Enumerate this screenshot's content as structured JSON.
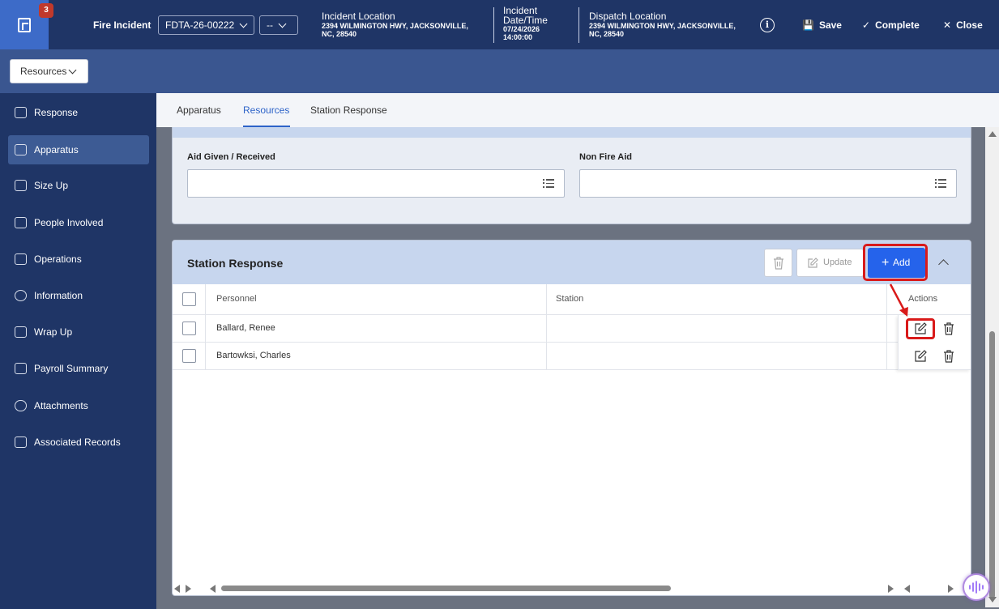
{
  "header": {
    "badge_count": "3",
    "title": "Fire Incident",
    "incident_id": "FDTA-26-00222",
    "secondary_select": "--",
    "incident_location_label": "Incident Location",
    "incident_location_value_line1": "2394 WILMINGTON HWY, JACKSONVILLE,",
    "incident_location_value_line2": "NC, 28540",
    "incident_datetime_label_line1": "Incident",
    "incident_datetime_label_line2": "Date/Time",
    "incident_datetime_value_line1": "07/24/2026",
    "incident_datetime_value_line2": "14:00:00",
    "dispatch_location_label": "Dispatch Location",
    "dispatch_location_value_line1": "2394 WILMINGTON HWY, JACKSONVILLE,",
    "dispatch_location_value_line2": "NC, 28540",
    "save_label": "Save",
    "complete_label": "Complete",
    "close_label": "Close"
  },
  "subbar": {
    "dropdown_label": "Resources"
  },
  "sidebar": {
    "items": [
      {
        "label": "Response",
        "icon": "response-icon"
      },
      {
        "label": "Apparatus",
        "icon": "apparatus-icon"
      },
      {
        "label": "Size Up",
        "icon": "size-up-icon"
      },
      {
        "label": "People Involved",
        "icon": "people-icon"
      },
      {
        "label": "Operations",
        "icon": "map-icon"
      },
      {
        "label": "Information",
        "icon": "info-icon"
      },
      {
        "label": "Wrap Up",
        "icon": "wrap-up-icon"
      },
      {
        "label": "Payroll Summary",
        "icon": "payroll-icon"
      },
      {
        "label": "Attachments",
        "icon": "paperclip-icon"
      },
      {
        "label": "Associated Records",
        "icon": "hierarchy-icon"
      }
    ],
    "active_index": 1
  },
  "tabs": [
    "Apparatus",
    "Resources",
    "Station Response"
  ],
  "active_tab": "Resources",
  "aid_section": {
    "aid_given_label": "Aid Given / Received",
    "non_fire_aid_label": "Non Fire Aid"
  },
  "station_response": {
    "title": "Station Response",
    "update_label": "Update",
    "add_label": "Add",
    "columns": [
      "Personnel",
      "Station",
      "Actions"
    ],
    "rows": [
      {
        "personnel": "Ballard, Renee",
        "station": ""
      },
      {
        "personnel": "Bartowksi, Charles",
        "station": ""
      }
    ]
  },
  "colors": {
    "header_bg": "#1f3566",
    "accent_blue": "#2563eb",
    "highlight_red": "#d91a1a",
    "badge_red": "#c0392b"
  }
}
